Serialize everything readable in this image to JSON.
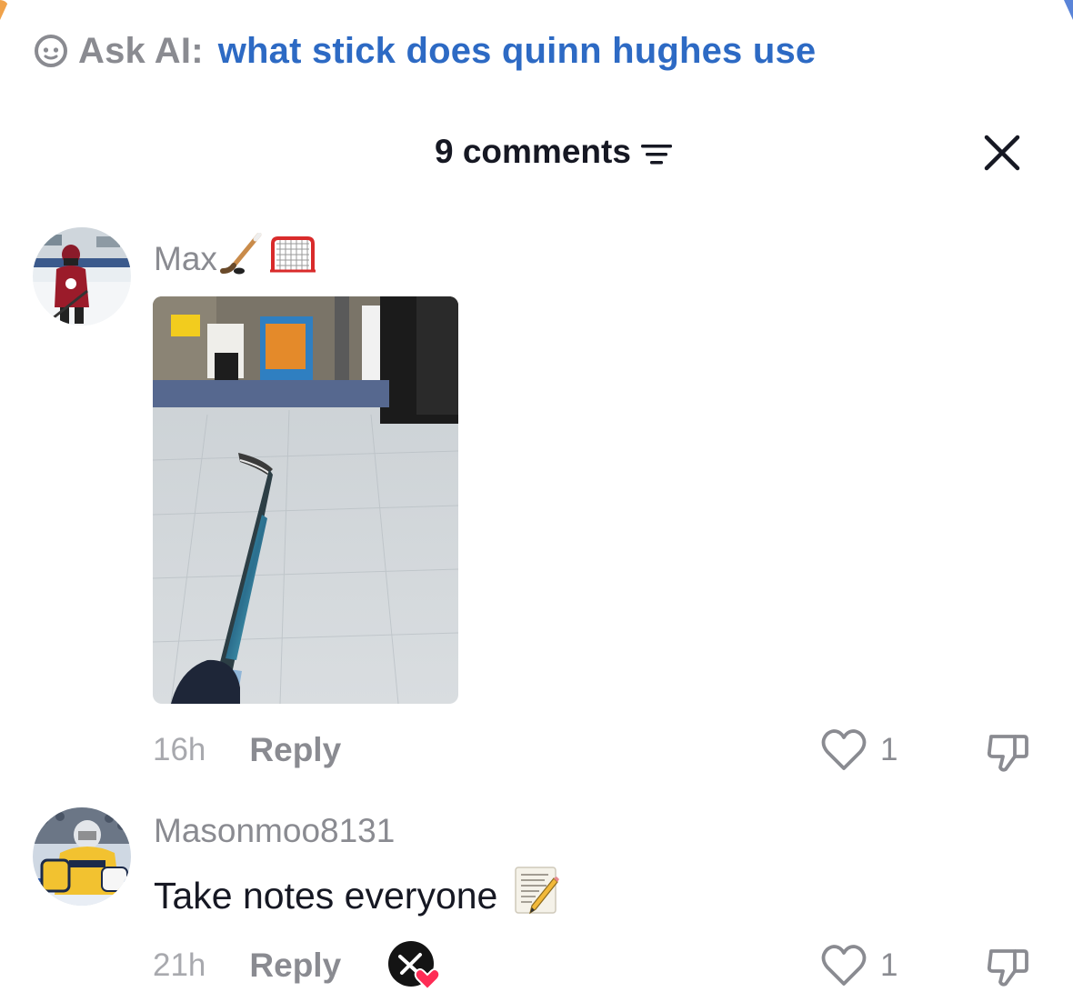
{
  "ask_ai": {
    "prefix": "Ask AI:",
    "query": "what stick does quinn hughes use",
    "icon": "ai-face-icon",
    "query_color": "#2d6ac4"
  },
  "header": {
    "count_label": "9 comments",
    "filter_icon": "sort-lines-icon",
    "close_icon": "close-icon"
  },
  "comments": [
    {
      "username": "Max",
      "username_emojis": [
        "hockey-stick-emoji",
        "goal-net-emoji"
      ],
      "avatar": "hockey-player-avatar",
      "attachment": "photo-hockey-stick-on-floor",
      "text": "",
      "time": "16h",
      "reply_label": "Reply",
      "likes": "1"
    },
    {
      "username": "Masonmoo8131",
      "avatar": "goalie-avatar",
      "text": "Take notes everyone",
      "text_emoji": "memo-pencil-emoji",
      "time": "21h",
      "reply_label": "Reply",
      "creator_liked_badge": "creator-liked-icon",
      "likes": "1"
    }
  ],
  "colors": {
    "text_primary": "#161823",
    "text_secondary": "#8a8b91",
    "accent_heart": "#fe2c55"
  }
}
